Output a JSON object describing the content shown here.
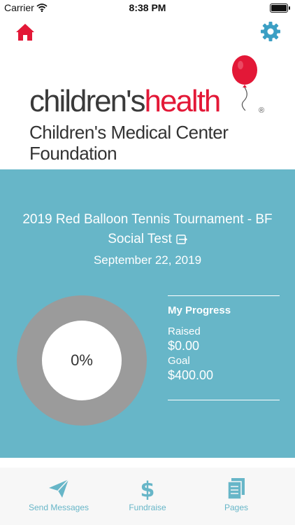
{
  "status_bar": {
    "carrier": "Carrier",
    "time": "8:38 PM"
  },
  "logo": {
    "brand_prefix": "children's",
    "brand_accent": "health",
    "registered": "®",
    "line1": "Children's Medical Center",
    "line2": "Foundation"
  },
  "event": {
    "title": "2019 Red Balloon Tennis Tournament - BF Social Test",
    "date": "September 22, 2019"
  },
  "progress": {
    "percent_label": "0%",
    "percent_value": 0,
    "heading": "My Progress",
    "raised_label": "Raised",
    "raised_value": "$0.00",
    "goal_label": "Goal",
    "goal_value": "$400.00"
  },
  "tabs": [
    {
      "label": "Send Messages",
      "icon": "paper-plane-icon"
    },
    {
      "label": "Fundraise",
      "icon": "dollar-icon"
    },
    {
      "label": "Pages",
      "icon": "pages-icon"
    }
  ],
  "colors": {
    "accent": "#67b6c8",
    "brand_red": "#e31837",
    "donut_track": "#9b9b9b"
  }
}
